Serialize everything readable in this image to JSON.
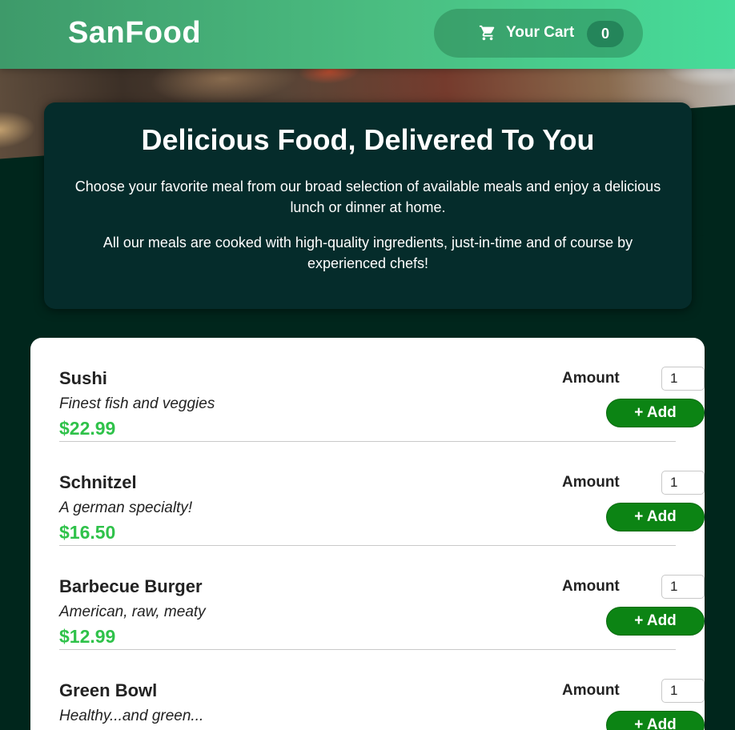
{
  "header": {
    "logo": "SanFood",
    "cart_label": "Your Cart",
    "cart_count": "0",
    "cart_icon": "cart-icon"
  },
  "summary": {
    "title": "Delicious Food, Delivered To You",
    "paragraph1": "Choose your favorite meal from our broad selection of available meals and enjoy a delicious lunch or dinner at home.",
    "paragraph2": "All our meals are cooked with high-quality ingredients, just-in-time and of course by experienced chefs!"
  },
  "meals": [
    {
      "name": "Sushi",
      "description": "Finest fish and veggies",
      "price": "$22.99",
      "amount_label": "Amount",
      "amount": "1",
      "add_label": "+ Add"
    },
    {
      "name": "Schnitzel",
      "description": "A german specialty!",
      "price": "$16.50",
      "amount_label": "Amount",
      "amount": "1",
      "add_label": "+ Add"
    },
    {
      "name": "Barbecue Burger",
      "description": "American, raw, meaty",
      "price": "$12.99",
      "amount_label": "Amount",
      "amount": "1",
      "add_label": "+ Add"
    },
    {
      "name": "Green Bowl",
      "description": "Healthy...and green...",
      "price": "",
      "amount_label": "Amount",
      "amount": "1",
      "add_label": "+ Add"
    }
  ],
  "colors": {
    "header_start": "#3e9a6a",
    "header_end": "#46dc9a",
    "background": "#00261c",
    "price": "#2fc24a",
    "add_button": "#0c8414"
  }
}
